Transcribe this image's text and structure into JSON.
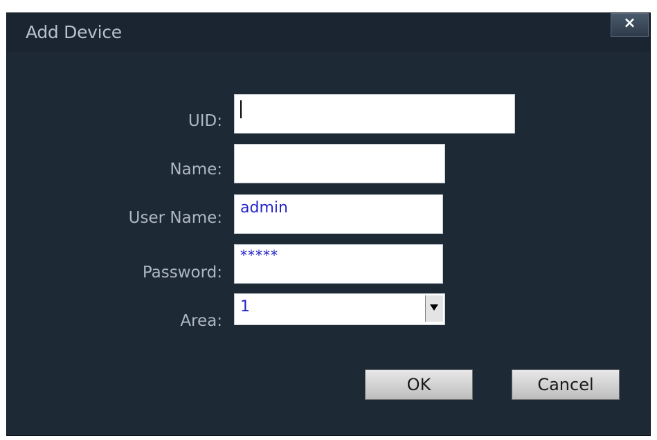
{
  "dialog": {
    "title": "Add Device",
    "close_label": "×"
  },
  "form": {
    "uid": {
      "label": "UID:",
      "value": ""
    },
    "name": {
      "label": "Name:",
      "value": ""
    },
    "user_name": {
      "label": "User Name:",
      "value": "admin"
    },
    "password": {
      "label": "Password:",
      "value": "*****"
    },
    "area": {
      "label": "Area:",
      "value": "1"
    }
  },
  "buttons": {
    "ok": "OK",
    "cancel": "Cancel"
  },
  "colors": {
    "dialog_bg": "#1e2936",
    "label_text": "#aeb8c2",
    "input_text": "#2626c8"
  },
  "icons": {
    "close": "close-icon",
    "dropdown": "chevron-down-icon"
  }
}
